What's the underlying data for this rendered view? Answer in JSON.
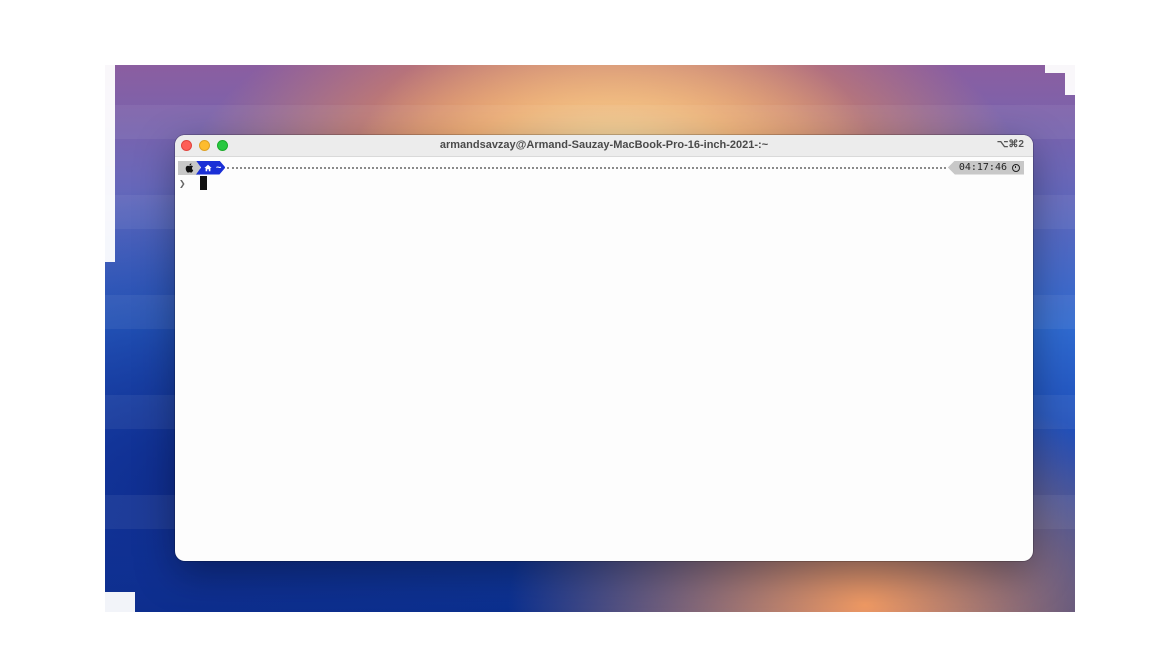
{
  "window": {
    "title": "armandsavzay@Armand-Sauzay-MacBook-Pro-16-inch-2021-:~",
    "shortcut": "⌥⌘2"
  },
  "prompt": {
    "os_icon": "apple-logo-icon",
    "home_icon": "home-icon",
    "directory": "~",
    "time": "04:17:46",
    "time_icon": "clock-icon",
    "input_symbol": "❯",
    "command_text": ""
  },
  "colors": {
    "directory_segment": "#1a2fd6",
    "segment_gray": "#c8c8c8",
    "close": "#fe5f57",
    "minimize": "#febc2e",
    "maximize": "#28c840"
  }
}
